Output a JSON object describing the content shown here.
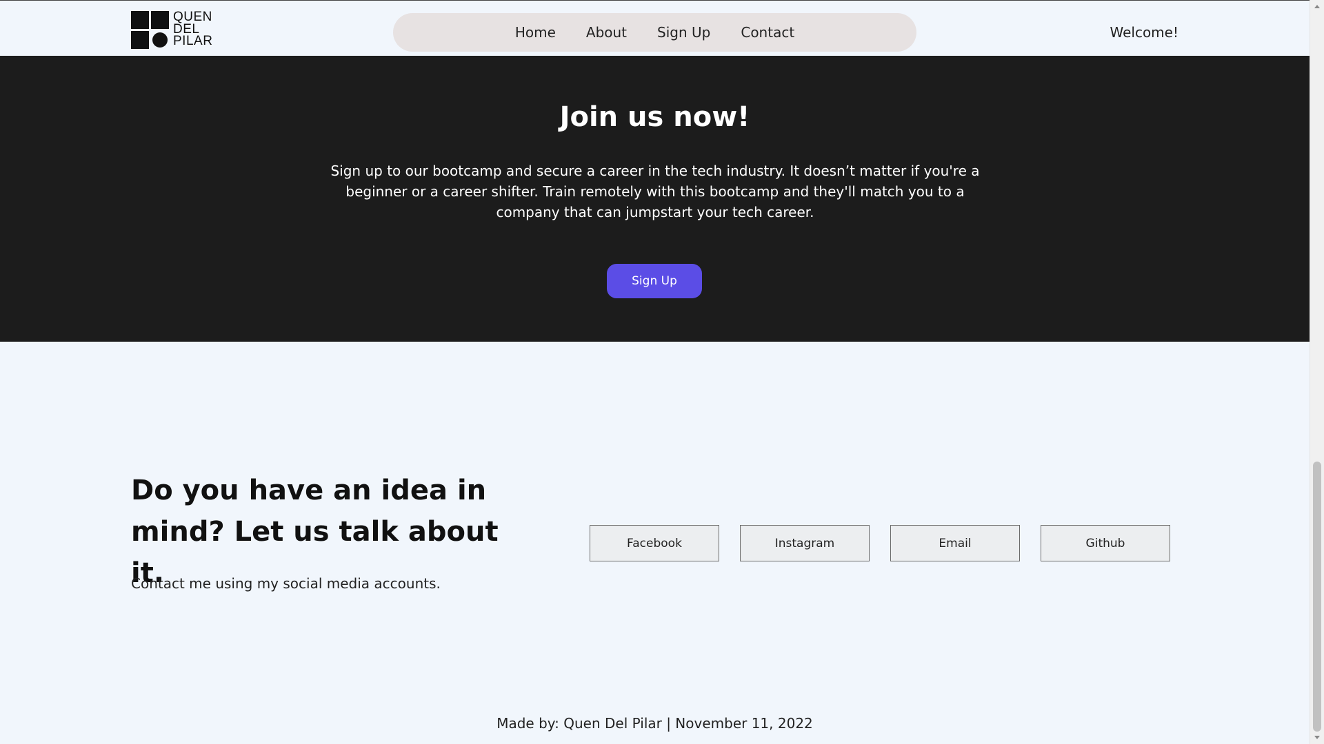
{
  "logo": {
    "line1": "QUEN",
    "line2": "DEL",
    "line3": "PILAR"
  },
  "nav": {
    "items": [
      {
        "label": "Home"
      },
      {
        "label": "About"
      },
      {
        "label": "Sign Up"
      },
      {
        "label": "Contact"
      }
    ]
  },
  "header": {
    "welcome": "Welcome!"
  },
  "join": {
    "title": "Join us now!",
    "description": "Sign up to our bootcamp and secure a career in the tech industry. It doesn’t matter if you're a beginner or a career shifter. Train remotely with this bootcamp and they'll match you to a company that can jumpstart your tech career.",
    "button_label": "Sign Up"
  },
  "contact": {
    "title": "Do you have an idea in mind? Let us talk about it.",
    "subtitle": "Contact me using my social media accounts.",
    "socials": [
      {
        "label": "Facebook"
      },
      {
        "label": "Instagram"
      },
      {
        "label": "Email"
      },
      {
        "label": "Github"
      }
    ]
  },
  "footer": {
    "text": "Made by: Quen Del Pilar | November 11, 2022"
  },
  "colors": {
    "background": "#f1f6fc",
    "dark_section": "#1c1c1c",
    "accent": "#5b4de6",
    "nav_pill": "#e7e2e2"
  }
}
